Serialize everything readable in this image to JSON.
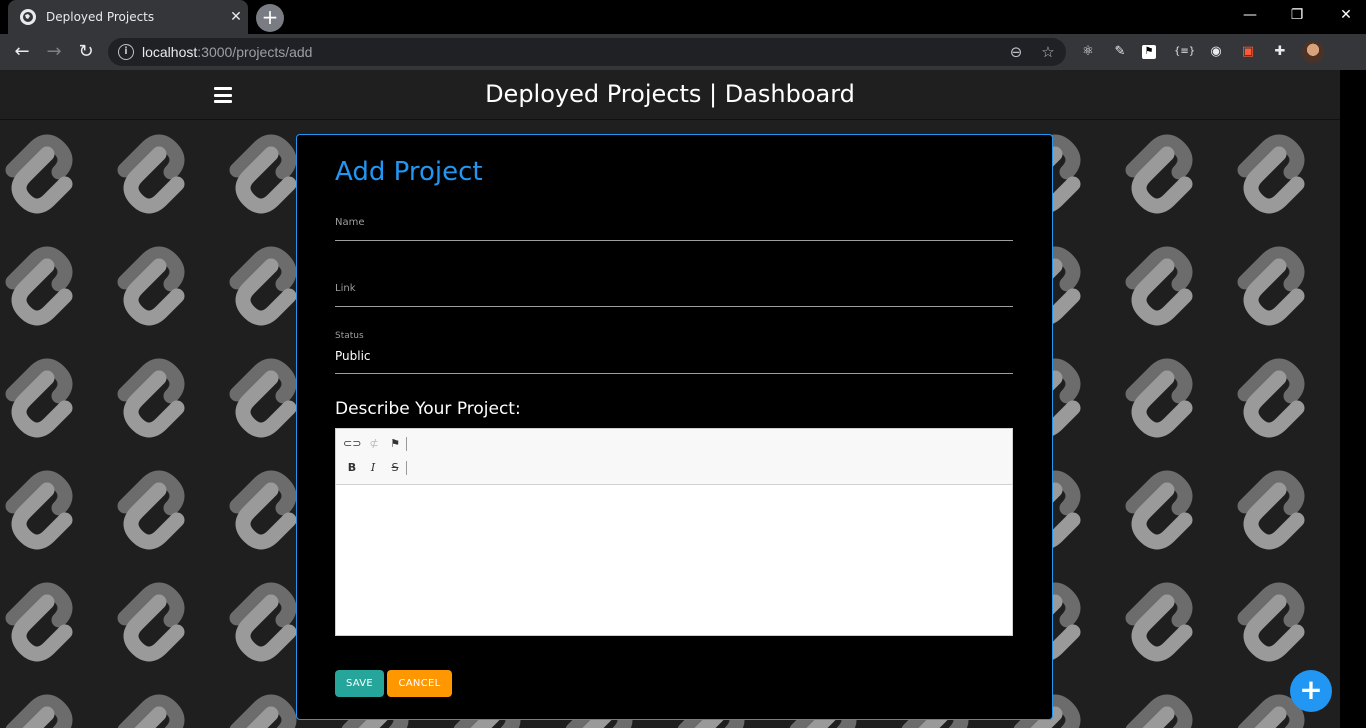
{
  "browser": {
    "tab_title": "Deployed Projects",
    "tab_close": "✕",
    "new_tab": "+",
    "url_host": "localhost",
    "url_path": ":3000/projects/add",
    "window_controls": {
      "minimize": "—",
      "restore": "❐",
      "close": "✕"
    },
    "extensions": [
      "react-devtools-icon",
      "pen-extension-icon",
      "flag-extension-icon",
      "json-viewer-icon",
      "owl-extension-icon",
      "shopping-extension-icon",
      "puzzle-extensions-icon"
    ]
  },
  "app": {
    "title": "Deployed Projects | Dashboard"
  },
  "form": {
    "heading": "Add Project",
    "name_label": "Name",
    "name_value": "",
    "link_label": "Link",
    "link_value": "",
    "status_label": "Status",
    "status_value": "Public",
    "description_label": "Describe Your Project:",
    "editor_buttons": [
      "link-icon",
      "unlink-icon",
      "flag-icon",
      "bold-icon",
      "italic-icon",
      "strikethrough-icon"
    ],
    "save_label": "SAVE",
    "cancel_label": "CANCEL"
  },
  "fab": {
    "label": "+"
  },
  "colors": {
    "accent": "#2196f3",
    "save": "#26a69a",
    "cancel": "#ff9800"
  }
}
